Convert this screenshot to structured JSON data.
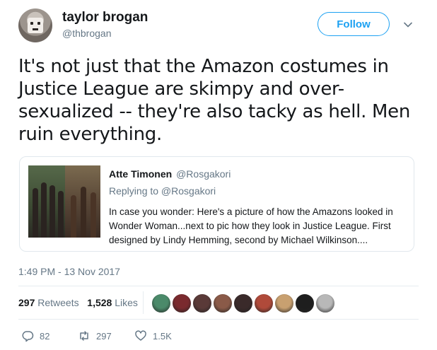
{
  "author": {
    "name": "taylor brogan",
    "handle": "@thbrogan"
  },
  "follow_label": "Follow",
  "tweet_text": "It's not just that the Amazon costumes in Justice League are skimpy and over-sexualized -- they're also tacky as hell. Men ruin everything.",
  "quoted": {
    "name": "Atte Timonen",
    "handle": "@Rosgakori",
    "replying_to": "Replying to @Rosgakori",
    "text": "In case you wonder: Here's a picture of how the Amazons looked in Wonder Woman...next to pic how they look in Justice League. First designed by Lindy Hemming, second by Michael Wilkinson...."
  },
  "timestamp": "1:49 PM - 13 Nov 2017",
  "stats": {
    "retweets_count": "297",
    "retweets_label": "Retweets",
    "likes_count": "1,528",
    "likes_label": "Likes"
  },
  "liker_colors": [
    "#4b8a6a",
    "#7a2a2e",
    "#5a3a38",
    "#8a5a48",
    "#3a2a2a",
    "#b04a3a",
    "#c8a070",
    "#1e1e1e",
    "#b8b8b8"
  ],
  "actions": {
    "reply_count": "82",
    "retweet_count": "297",
    "like_count": "1.5K"
  },
  "colors": {
    "accent": "#1da1f2",
    "secondary_text": "#657786"
  }
}
